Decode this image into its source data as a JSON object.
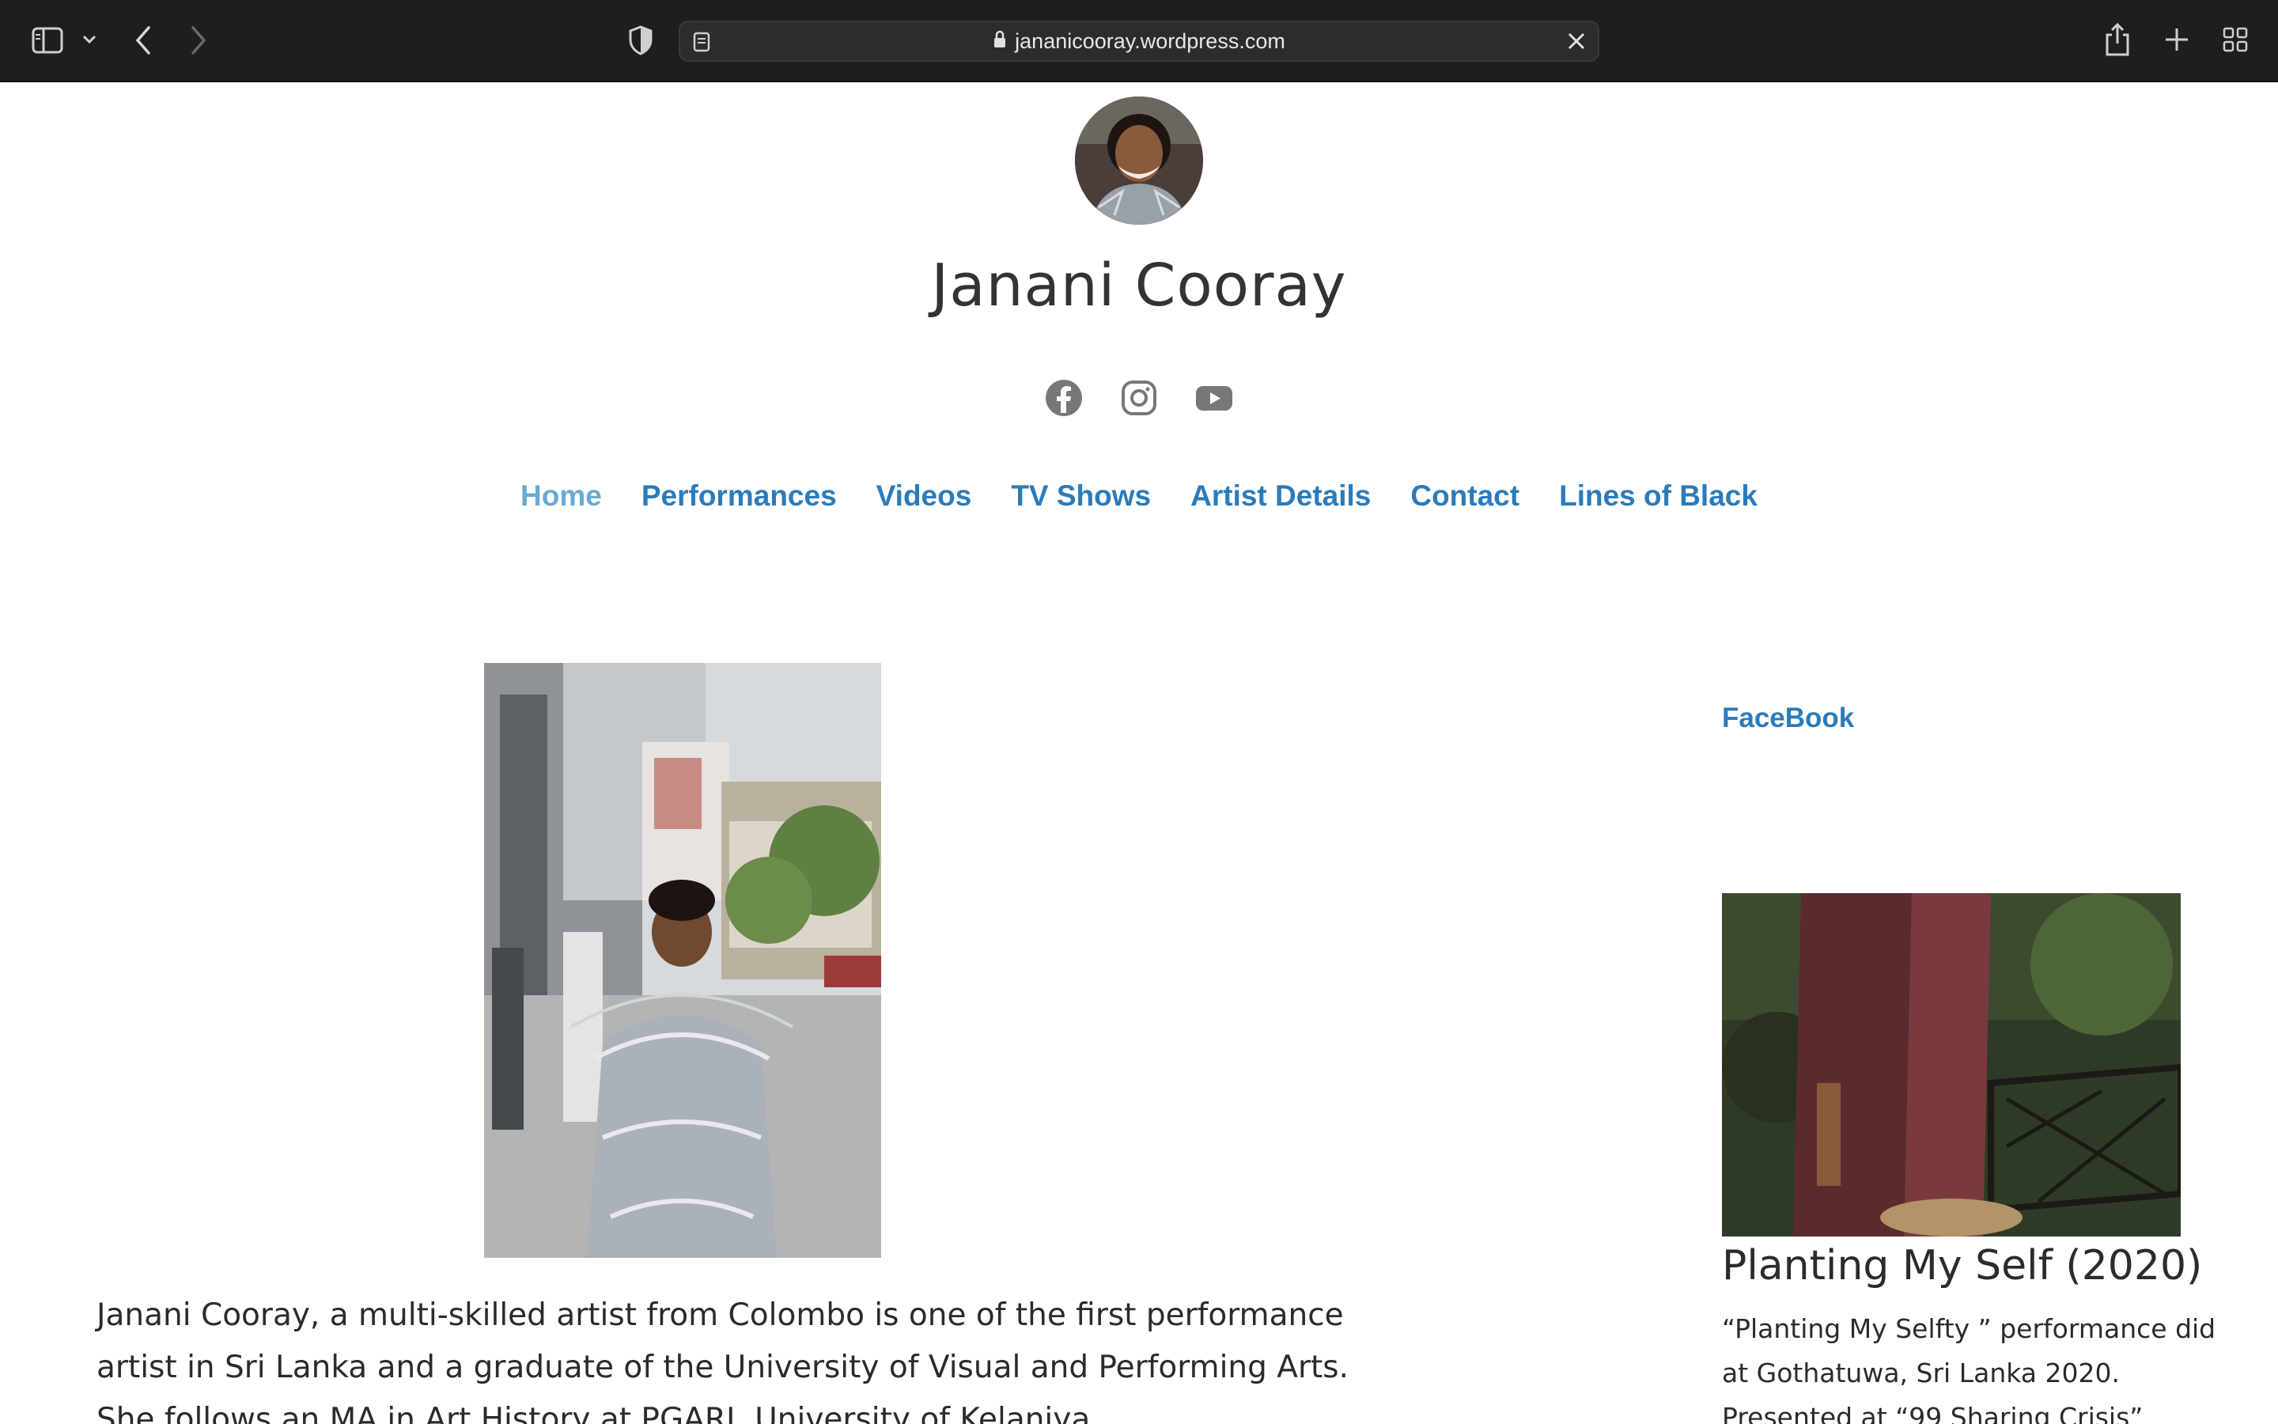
{
  "browser": {
    "url": "jananicooray.wordpress.com"
  },
  "site": {
    "title": "Janani Cooray",
    "social": [
      "facebook-icon",
      "instagram-icon",
      "youtube-icon"
    ]
  },
  "nav": {
    "items": [
      {
        "label": "Home",
        "current": true
      },
      {
        "label": "Performances"
      },
      {
        "label": "Videos"
      },
      {
        "label": "TV Shows"
      },
      {
        "label": "Artist Details"
      },
      {
        "label": "Contact"
      },
      {
        "label": "Lines of Black"
      }
    ]
  },
  "main": {
    "intro_lines": [
      "Janani Cooray, a multi-skilled artist from Colombo is one of the first performance",
      "artist in Sri Lanka and a graduate of the University of Visual and Performing Arts.",
      "She follows an MA in Art History at PGARI, University of Kelaniya."
    ]
  },
  "sidebar": {
    "facebook_label": "FaceBook",
    "post_title": "Planting My Self (2020)",
    "post_desc_lines": [
      "“Planting My Selfty ” performance did",
      "at Gothatuwa, Sri Lanka 2020.",
      "Presented at “99 Sharing Crisis”"
    ]
  },
  "colors": {
    "link": "#2b7bb9",
    "link_current": "#6aaad4",
    "toolbar": "#1e1e1e"
  }
}
